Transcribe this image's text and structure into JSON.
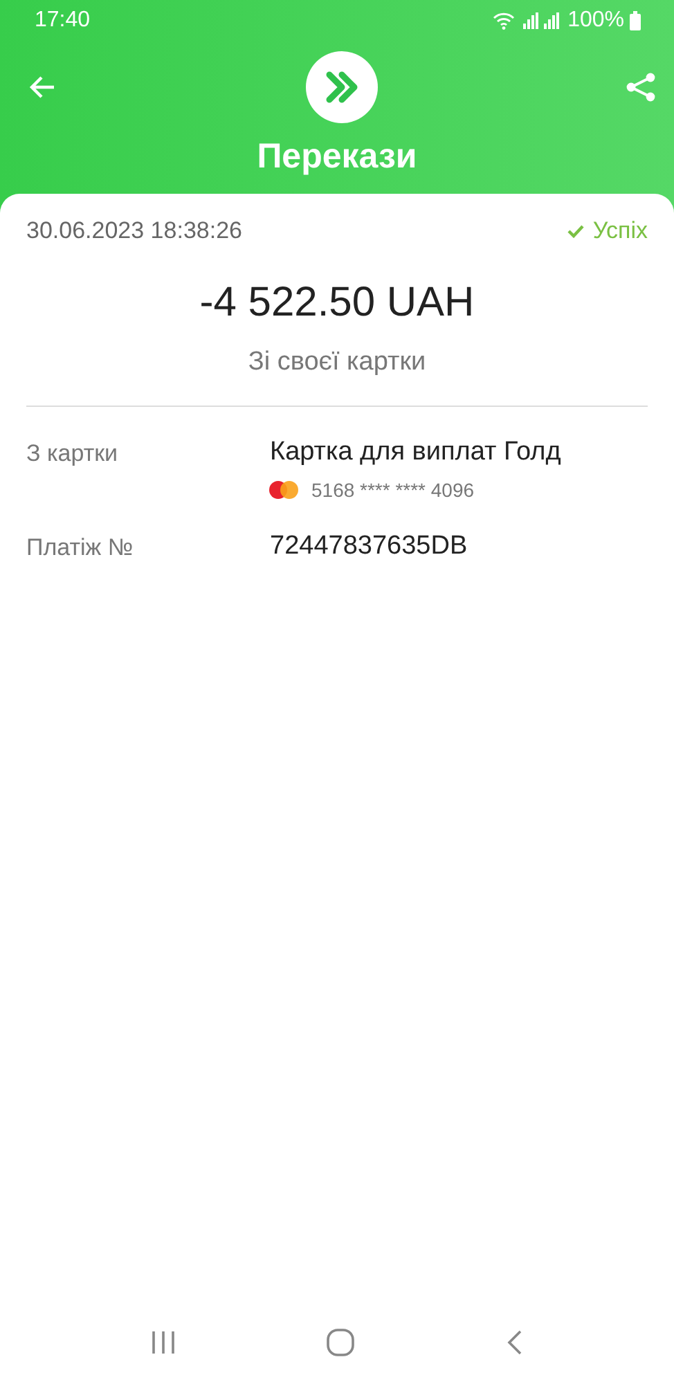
{
  "status_bar": {
    "time": "17:40",
    "battery": "100%"
  },
  "header": {
    "title": "Перекази"
  },
  "transaction": {
    "datetime": "30.06.2023 18:38:26",
    "status": {
      "label": "Успіх",
      "kind": "success"
    },
    "amount": "-4 522.50 UAH",
    "description": "Зі своєї картки"
  },
  "details": [
    {
      "label": "З картки",
      "value": "Картка для виплат Голд",
      "card_number": "5168 **** **** 4096"
    },
    {
      "label": "Платіж №",
      "value": "72447837635DB"
    }
  ]
}
